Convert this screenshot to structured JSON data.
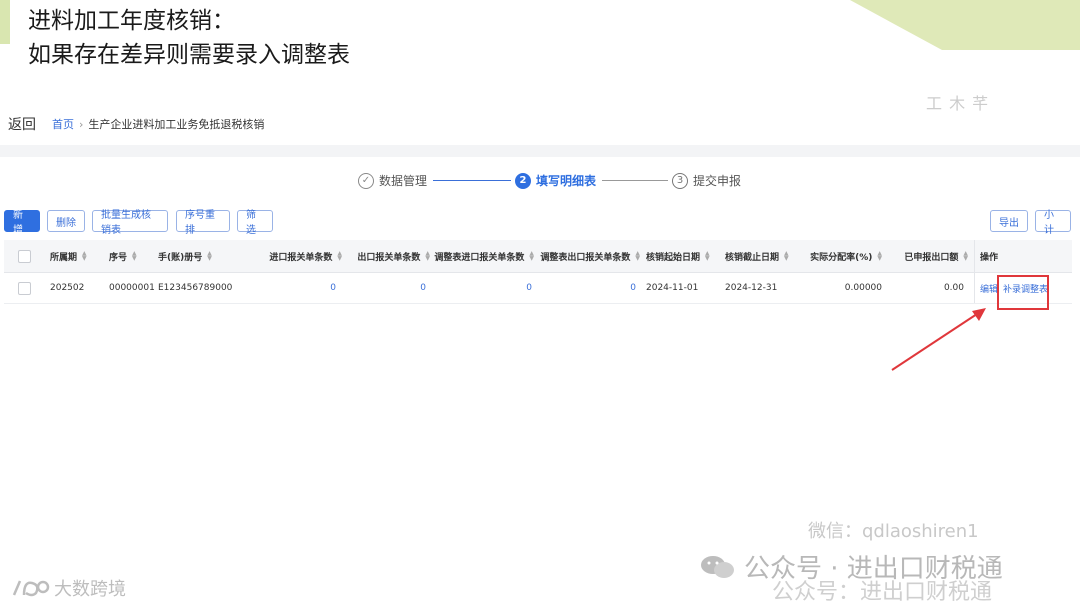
{
  "slide": {
    "title_line1": "进料加工年度核销：",
    "title_line2": "如果存在差异则需要录入调整表",
    "top_watermark": "工 木 芊"
  },
  "breadcrumb": {
    "back": "返回",
    "home": "首页",
    "separator": "›",
    "current": "生产企业进料加工业务免抵退税核销"
  },
  "steps": [
    {
      "num": "✓",
      "label": "数据管理",
      "state": "done"
    },
    {
      "num": "2",
      "label": "填写明细表",
      "state": "active"
    },
    {
      "num": "3",
      "label": "提交申报",
      "state": "pending"
    }
  ],
  "toolbar": {
    "add": "新增",
    "delete": "删除",
    "batch_generate": "批量生成核销表",
    "reorder": "序号重排",
    "filter": "筛选",
    "export": "导出",
    "subtotal": "小计"
  },
  "table": {
    "headers": {
      "period": "所属期",
      "seq": "序号",
      "manual_no": "手(账)册号",
      "import_count": "进口报关单条数",
      "export_count": "出口报关单条数",
      "adj_import_count": "调整表进口报关单条数",
      "adj_export_count": "调整表出口报关单条数",
      "start_date": "核销起始日期",
      "end_date": "核销截止日期",
      "ratio": "实际分配率(%)",
      "declared_export": "已申报出口额",
      "ops": "操作"
    },
    "rows": [
      {
        "period": "202502",
        "seq": "00000001",
        "manual_no": "E123456789000",
        "import_count": "0",
        "export_count": "0",
        "adj_import_count": "0",
        "adj_export_count": "0",
        "start_date": "2024-11-01",
        "end_date": "2024-12-31",
        "ratio": "0.00000",
        "declared_export": "0.00",
        "edit": "编辑",
        "supplement": "补录调整表"
      }
    ]
  },
  "watermarks": {
    "wechat_id": "微信：qdlaoshiren1",
    "public_account": "公众号 · 进出口财税通",
    "public_account_2": "公众号：进出口财税通",
    "left_brand": "大数跨境"
  },
  "colors": {
    "accent": "#2f6fe0",
    "highlight": "#e0373b",
    "deco": "#dfe9b8"
  }
}
